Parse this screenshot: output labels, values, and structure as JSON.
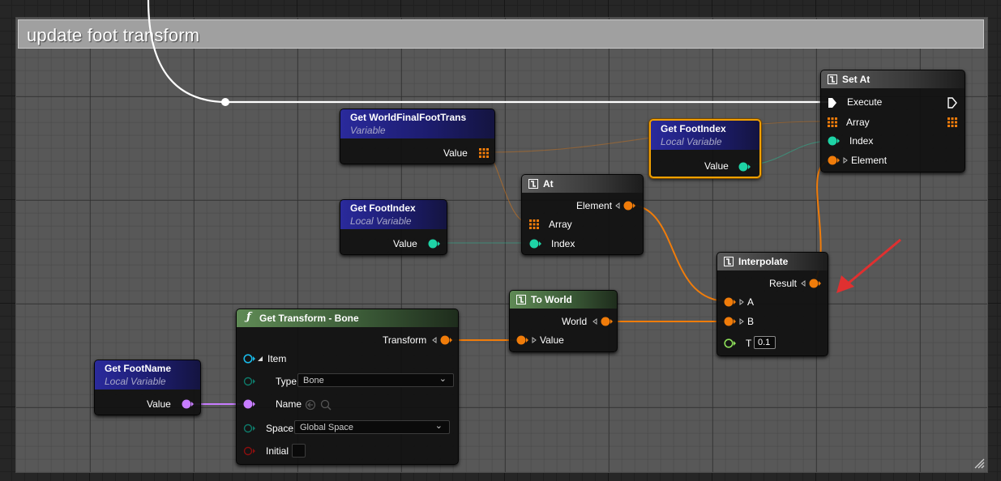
{
  "comment": {
    "title": "update foot transform"
  },
  "nodes": {
    "set_at": {
      "title": "Set At",
      "pins": {
        "execute": "Execute",
        "array": "Array",
        "index": "Index",
        "element": "Element"
      }
    },
    "get_world_final_foot_trans": {
      "title": "Get WorldFinalFootTrans",
      "subtitle": "Variable",
      "value": "Value"
    },
    "get_foot_index_top": {
      "title": "Get FootIndex",
      "subtitle": "Local Variable",
      "value": "Value"
    },
    "get_foot_index": {
      "title": "Get FootIndex",
      "subtitle": "Local Variable",
      "value": "Value"
    },
    "array_at": {
      "title": "At",
      "pins": {
        "element": "Element",
        "array": "Array",
        "index": "Index"
      }
    },
    "interpolate": {
      "title": "Interpolate",
      "pins": {
        "result": "Result",
        "a": "A",
        "b": "B",
        "t": "T"
      },
      "t_value": "0.1"
    },
    "to_world": {
      "title": "To World",
      "pins": {
        "world": "World",
        "value": "Value"
      }
    },
    "get_transform_bone": {
      "title": "Get Transform - Bone",
      "pins": {
        "transform": "Transform",
        "item": "Item",
        "type": "Type",
        "name": "Name",
        "space": "Space",
        "initial": "Initial"
      },
      "type_value": "Bone",
      "space_value": "Global Space"
    },
    "get_foot_name": {
      "title": "Get FootName",
      "subtitle": "Local Variable",
      "value": "Value"
    }
  },
  "colors": {
    "transform_wire": "#f07c0a",
    "integer_wire": "#1ed4a6",
    "name_wire": "#c77cff",
    "exec_wire": "#ffffff",
    "selection": "#f0a000",
    "annotation_arrow": "#e03030"
  },
  "icons": {
    "node": "node-icon",
    "function": "function-icon",
    "exec": "exec-pin-icon",
    "array": "array-grid-icon",
    "dropdown": "chevron-down-icon",
    "reroute": "reroute-knot-icon",
    "resize": "resize-grip-icon",
    "annotation": "red-arrow-icon"
  }
}
